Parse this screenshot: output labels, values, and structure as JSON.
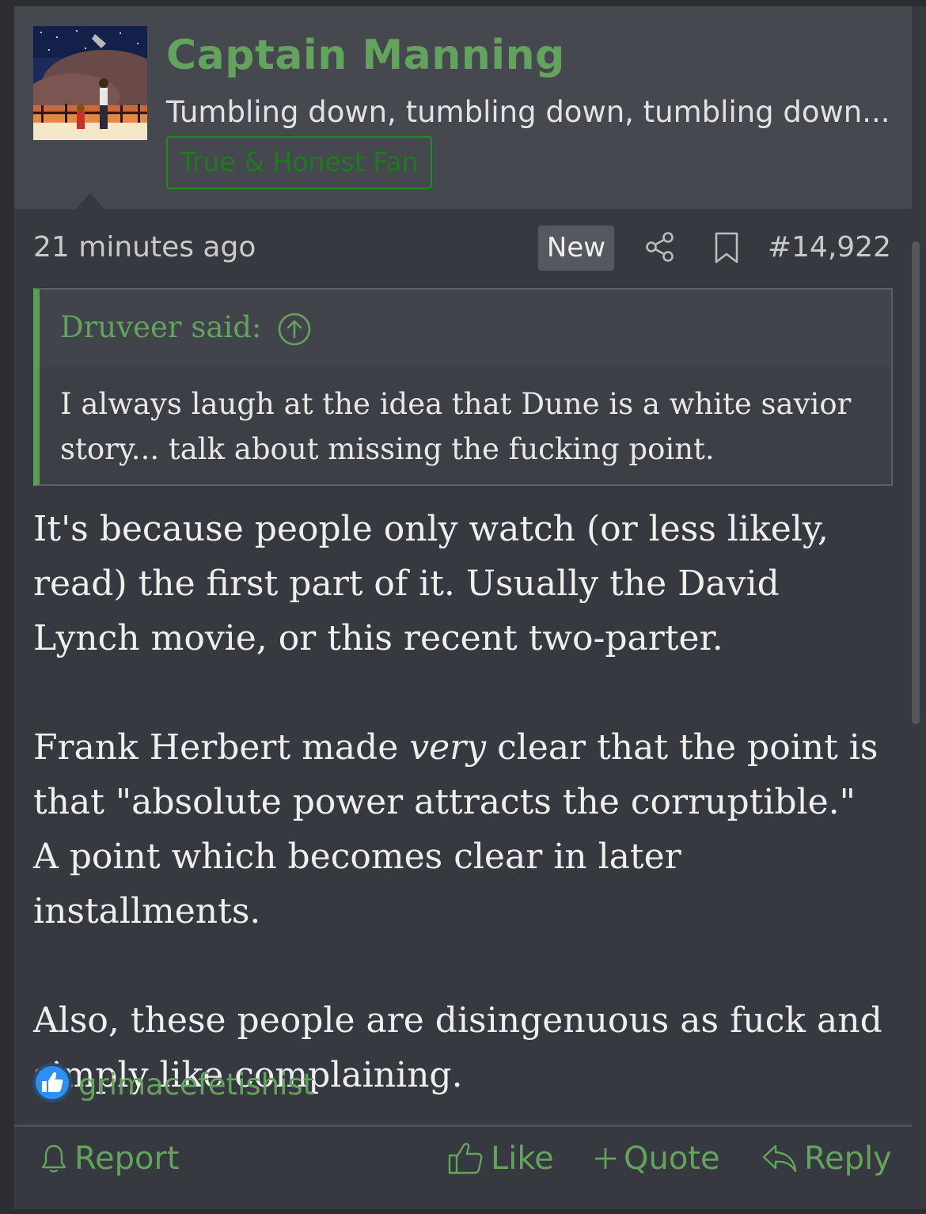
{
  "user": {
    "name": "Captain Manning",
    "title": "Tumbling down, tumbling down, tumbling down...",
    "banner": "True & Honest Fan"
  },
  "meta": {
    "time": "21 minutes ago",
    "new_badge": "New",
    "post_number": "#14,922"
  },
  "quote": {
    "author": "Druveer said:",
    "text": "I always laugh at the idea that Dune is a white savior story... talk about missing the fucking point."
  },
  "body": {
    "p1": "It's because people only watch (or less likely, read) the first part of it. Usually the David Lynch movie, or this recent two-parter.",
    "p2_before": "Frank Herbert made ",
    "p2_em": "very",
    "p2_after": " clear that the point is that \"absolute power attracts the corruptible.\" A point which becomes clear in later installments.",
    "p3": "Also, these people are disingenuous as fuck and simply like complaining."
  },
  "reactions": {
    "user": "grimacefetishist",
    "icon": "thumbs-up-icon"
  },
  "actions": {
    "report": "Report",
    "like": "Like",
    "quote": "Quote",
    "reply": "Reply"
  },
  "colors": {
    "accent_green": "#63a35d",
    "background": "#36393f",
    "header_bg": "#45484e"
  }
}
